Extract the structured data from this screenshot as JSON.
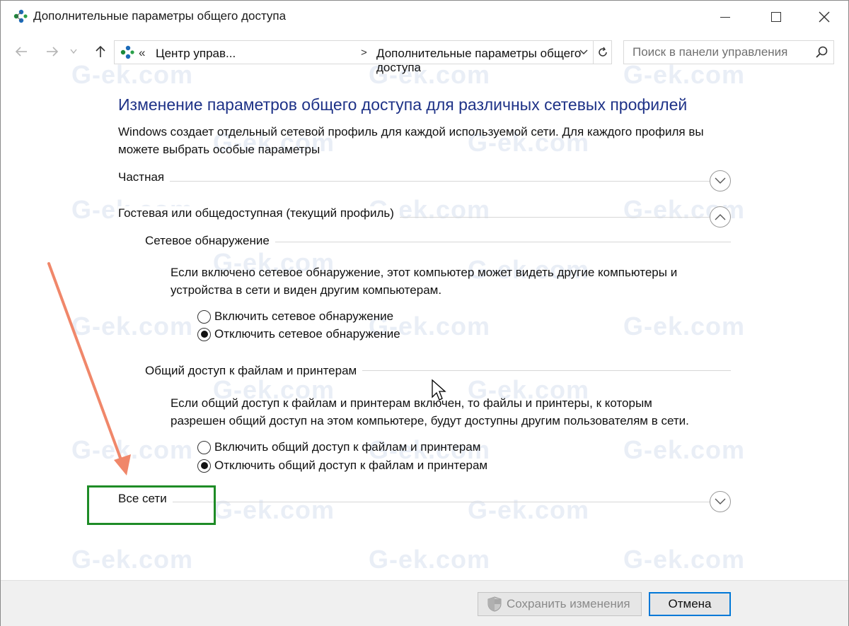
{
  "window": {
    "title": "Дополнительные параметры общего доступа"
  },
  "navigation": {
    "back_icon": "arrow-left-icon",
    "forward_icon": "arrow-right-icon",
    "up_icon": "arrow-up-icon",
    "address": {
      "overflow": "«",
      "crumb1": "Центр управ...",
      "separator": ">",
      "crumb2": "Дополнительные параметры общего доступа"
    },
    "search_placeholder": "Поиск в панели управления"
  },
  "main": {
    "title": "Изменение параметров общего доступа для различных сетевых профилей",
    "description_lines": [
      "Windows создает отдельный сетевой профиль для каждой используемой сети. Для каждого профиля вы",
      "можете выбрать особые параметры"
    ],
    "profiles": [
      {
        "label": "Частная",
        "expanded": false
      },
      {
        "label": "Гостевая или общедоступная (текущий профиль)",
        "expanded": true
      },
      {
        "label": "Все сети",
        "expanded": false
      }
    ],
    "network_discovery": {
      "heading": "Сетевое обнаружение",
      "text_lines": [
        "Если включено сетевое обнаружение, этот компьютер может видеть другие компьютеры и",
        "устройства в сети и виден другим компьютерам."
      ],
      "options": [
        {
          "label": "Включить сетевое обнаружение",
          "selected": false
        },
        {
          "label": "Отключить сетевое обнаружение",
          "selected": true
        }
      ]
    },
    "file_sharing": {
      "heading": "Общий доступ к файлам и принтерам",
      "text_lines": [
        "Если общий доступ к файлам и принтерам включен, то файлы и принтеры, к которым",
        "разрешен общий доступ на этом компьютере, будут доступны другим пользователям в сети."
      ],
      "options": [
        {
          "label": "Включить общий доступ к файлам и принтерам",
          "selected": false
        },
        {
          "label": "Отключить общий доступ к файлам и принтерам",
          "selected": true
        }
      ]
    }
  },
  "footer": {
    "save_label": "Сохранить изменения",
    "cancel_label": "Отмена"
  },
  "watermark": "G-ek.com",
  "colors": {
    "title_blue": "#1e3287",
    "annotation_green": "#1e8c26",
    "annotation_arrow": "#f0876a",
    "focus_blue": "#0078d7"
  }
}
